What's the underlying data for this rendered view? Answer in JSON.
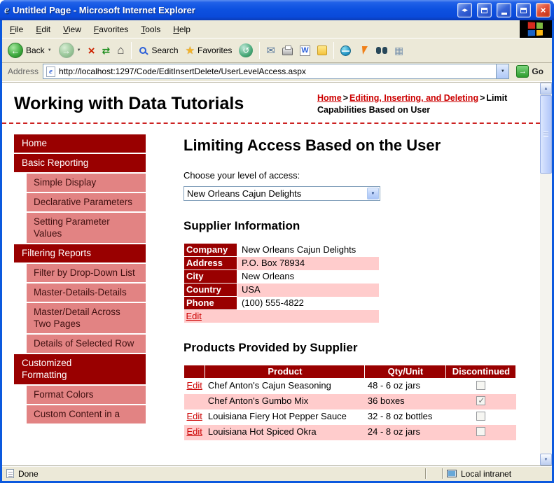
{
  "icons": {
    "win_shrink": "◂▸",
    "close": "×",
    "back_arrow": "←",
    "forward_arrow": "→",
    "stop": "×",
    "refresh": "⇄",
    "home": "⌂",
    "history": "↺",
    "star": "★",
    "mail": "✉",
    "word": "W",
    "grid": "▦",
    "dropdown": "▼",
    "up": "▲",
    "down": "▼",
    "go_arrow": "→",
    "crumb_sep": ">",
    "ie_e": "e"
  },
  "window": {
    "title": "Untitled Page - Microsoft Internet Explorer"
  },
  "menu": {
    "items": [
      "File",
      "Edit",
      "View",
      "Favorites",
      "Tools",
      "Help"
    ]
  },
  "toolbar": {
    "back": "Back",
    "search": "Search",
    "favorites": "Favorites"
  },
  "address": {
    "label": "Address",
    "url": "http://localhost:1297/Code/EditInsertDelete/UserLevelAccess.aspx",
    "go": "Go"
  },
  "header": {
    "site_title": "Working with Data Tutorials",
    "breadcrumb": {
      "home": "Home",
      "section": "Editing, Inserting, and Deleting",
      "current": "Limit Capabilities Based on User"
    }
  },
  "sidebar": {
    "items": [
      {
        "label": "Home"
      },
      {
        "label": "Basic Reporting"
      },
      {
        "label": "Simple Display"
      },
      {
        "label": "Declarative Parameters"
      },
      {
        "label": "Setting Parameter Values"
      },
      {
        "label": "Filtering Reports"
      },
      {
        "label": "Filter by Drop-Down List"
      },
      {
        "label": "Master-Details-Details"
      },
      {
        "label": "Master/Detail Across Two Pages"
      },
      {
        "label": "Details of Selected Row"
      },
      {
        "label": "Customized Formatting"
      },
      {
        "label": "Format Colors"
      },
      {
        "label": "Custom Content in a"
      }
    ]
  },
  "main": {
    "title": "Limiting Access Based on the User",
    "access_label": "Choose your level of access:",
    "access_selected": "New Orleans Cajun Delights",
    "supplier": {
      "heading": "Supplier Information",
      "fields": [
        {
          "label": "Company",
          "value": "New Orleans Cajun Delights"
        },
        {
          "label": "Address",
          "value": "P.O. Box 78934"
        },
        {
          "label": "City",
          "value": "New Orleans"
        },
        {
          "label": "Country",
          "value": "USA"
        },
        {
          "label": "Phone",
          "value": "(100) 555-4822"
        }
      ],
      "edit": "Edit"
    },
    "products": {
      "heading": "Products Provided by Supplier",
      "headers": {
        "product": "Product",
        "qty": "Qty/Unit",
        "discontinued": "Discontinued"
      },
      "rows": [
        {
          "edit": "Edit",
          "product": "Chef Anton's Cajun Seasoning",
          "qty": "48 - 6 oz jars",
          "discontinued": false
        },
        {
          "edit": "",
          "product": "Chef Anton's Gumbo Mix",
          "qty": "36 boxes",
          "discontinued": true
        },
        {
          "edit": "Edit",
          "product": "Louisiana Fiery Hot Pepper Sauce",
          "qty": "32 - 8 oz bottles",
          "discontinued": false
        },
        {
          "edit": "Edit",
          "product": "Louisiana Hot Spiced Okra",
          "qty": "24 - 8 oz jars",
          "discontinued": false
        }
      ]
    }
  },
  "status": {
    "done": "Done",
    "zone": "Local intranet"
  },
  "colors": {
    "maroon": "#990000",
    "salmon": "#e28383",
    "row_pink": "#ffcccc",
    "link_red": "#cc0000",
    "chrome": "#ece9d8",
    "frame_blue": "#0c59de"
  }
}
